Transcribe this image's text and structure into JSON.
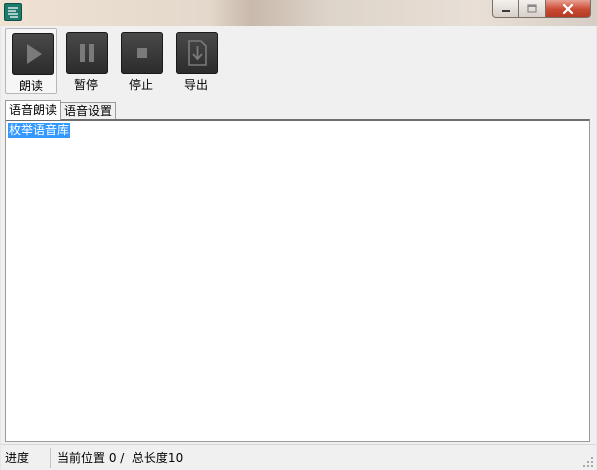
{
  "window": {
    "app_icon": "app-logo-icon",
    "caption_buttons": [
      "minimize-icon",
      "maximize-icon",
      "close-icon"
    ]
  },
  "toolbar": {
    "items": [
      {
        "label": "朗读",
        "icon": "play-icon"
      },
      {
        "label": "暂停",
        "icon": "pause-icon"
      },
      {
        "label": "停止",
        "icon": "stop-icon"
      },
      {
        "label": "导出",
        "icon": "export-icon"
      }
    ]
  },
  "tabs": [
    {
      "label": "语音朗读",
      "selected": true
    },
    {
      "label": "语音设置",
      "selected": false
    }
  ],
  "editor": {
    "content": "枚举语音库",
    "selected": true
  },
  "status": {
    "progress_label": "进度",
    "position_text": "当前位置 0 /  总长度10"
  },
  "colors": {
    "selection": "#3399ff",
    "close_button": "#c94a33",
    "toolbar_icon_bg": "#2b2b2b"
  }
}
